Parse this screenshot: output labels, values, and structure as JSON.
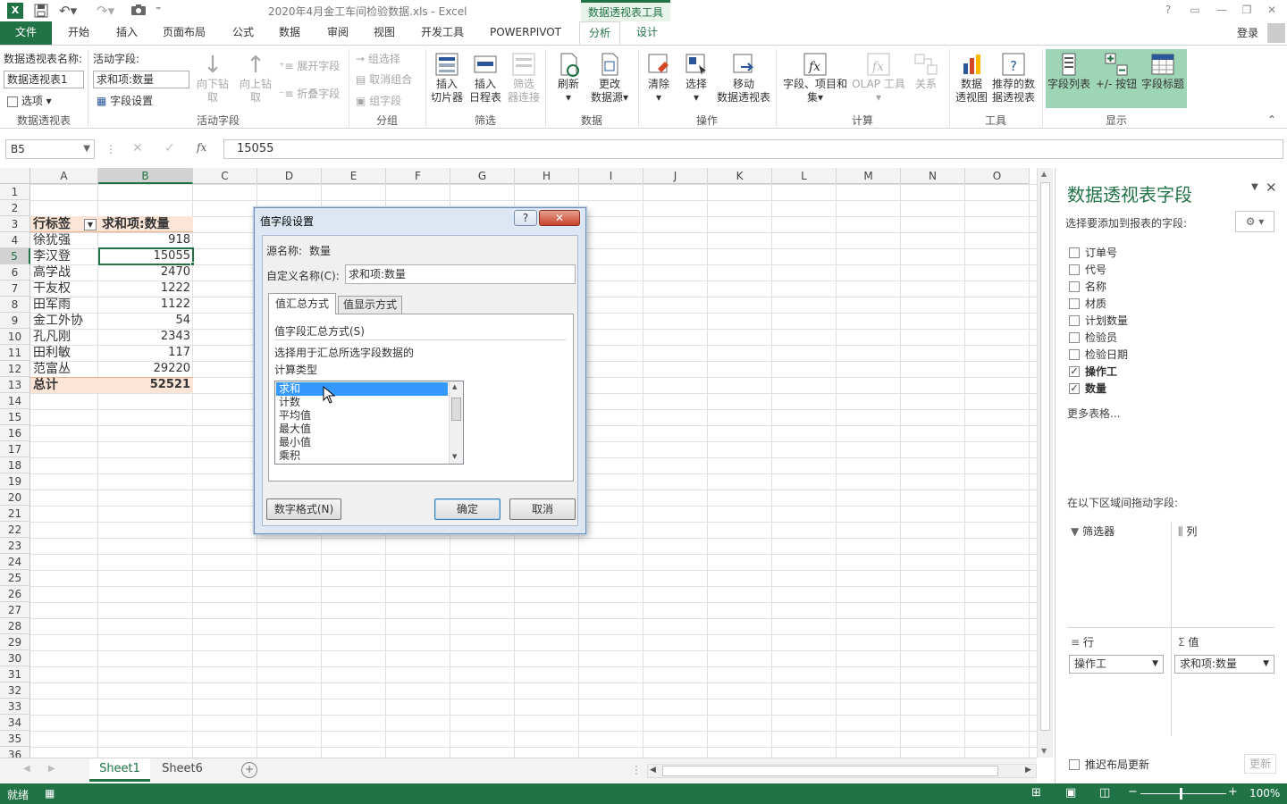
{
  "window": {
    "title": "2020年4月金工车间检验数据.xls - Excel",
    "context_tools": "数据透视表工具",
    "login": "登录"
  },
  "tabs": [
    "文件",
    "开始",
    "插入",
    "页面布局",
    "公式",
    "数据",
    "审阅",
    "视图",
    "开发工具",
    "POWERPIVOT",
    "分析",
    "设计"
  ],
  "ribbon": {
    "pt_name_label": "数据透视表名称:",
    "pt_name_value": "数据透视表1",
    "options_label": "选项",
    "active_field_label": "活动字段:",
    "active_field_value": "求和项:数量",
    "field_settings": "字段设置",
    "drill_down": "向下钻取",
    "drill_up": "向上钻取",
    "expand_field": "展开字段",
    "collapse_field": "折叠字段",
    "group_selection": "组选择",
    "ungroup": "取消组合",
    "group_field": "组字段",
    "insert_slicer_1": "插入",
    "insert_slicer_2": "切片器",
    "insert_timeline_1": "插入",
    "insert_timeline_2": "日程表",
    "filter_conn_1": "筛选",
    "filter_conn_2": "器连接",
    "refresh": "刷新",
    "change_source_1": "更改",
    "change_source_2": "数据源",
    "clear": "清除",
    "select": "选择",
    "move_pt_1": "移动",
    "move_pt_2": "数据透视表",
    "fields_items_1": "字段、项目和",
    "fields_items_2": "集",
    "olap_tools": "OLAP 工具",
    "relationships": "关系",
    "pivot_chart_1": "数据",
    "pivot_chart_2": "透视图",
    "recommended_1": "推荐的数",
    "recommended_2": "据透视表",
    "field_list": "字段列表",
    "buttons": "+/- 按钮",
    "field_headers": "字段标题",
    "groups": {
      "pivot_table": "数据透视表",
      "active_field": "活动字段",
      "group": "分组",
      "filter": "筛选",
      "data": "数据",
      "actions": "操作",
      "calculations": "计算",
      "tools": "工具",
      "show": "显示"
    }
  },
  "formula_bar": {
    "name_box": "B5",
    "formula": "15055",
    "fx": "fx"
  },
  "columns": [
    "A",
    "B",
    "C",
    "D",
    "E",
    "F",
    "G",
    "H",
    "I",
    "J",
    "K",
    "L",
    "M",
    "N",
    "O"
  ],
  "rows": [
    "1",
    "2",
    "3",
    "4",
    "5",
    "6",
    "7",
    "8",
    "9",
    "10",
    "11",
    "12",
    "13",
    "14",
    "15",
    "16",
    "17",
    "18",
    "19",
    "20",
    "21",
    "22",
    "23",
    "24",
    "25",
    "26",
    "27",
    "28",
    "29",
    "30",
    "31",
    "32",
    "33",
    "34",
    "35",
    "36"
  ],
  "pivot": {
    "header_label": "行标签",
    "header_value": "求和项:数量",
    "items": [
      {
        "name": "徐犹强",
        "value": "918"
      },
      {
        "name": "李汉登",
        "value": "15055"
      },
      {
        "name": "高学战",
        "value": "2470"
      },
      {
        "name": "干友权",
        "value": "1222"
      },
      {
        "name": "田军雨",
        "value": "1122"
      },
      {
        "name": "金工外协",
        "value": "54"
      },
      {
        "name": "孔凡刚",
        "value": "2343"
      },
      {
        "name": "田利敏",
        "value": "117"
      },
      {
        "name": "范富丛",
        "value": "29220"
      }
    ],
    "total_label": "总计",
    "total_value": "52521"
  },
  "dialog": {
    "title": "值字段设置",
    "help": "?",
    "source_label": "源名称:",
    "source_value": "数量",
    "custom_name_label": "自定义名称(C):",
    "custom_name_value": "求和项:数量",
    "tab_summarize": "值汇总方式",
    "tab_show_as": "值显示方式",
    "section_title": "值字段汇总方式(S)",
    "description_1": "选择用于汇总所选字段数据的",
    "description_2": "计算类型",
    "calc_types": [
      "求和",
      "计数",
      "平均值",
      "最大值",
      "最小值",
      "乘积"
    ],
    "selected": "求和",
    "number_format": "数字格式(N)",
    "ok": "确定",
    "cancel": "取消"
  },
  "field_pane": {
    "title": "数据透视表字段",
    "subtitle": "选择要添加到报表的字段:",
    "fields": [
      {
        "name": "订单号",
        "checked": false
      },
      {
        "name": "代号",
        "checked": false
      },
      {
        "name": "名称",
        "checked": false
      },
      {
        "name": "材质",
        "checked": false
      },
      {
        "name": "计划数量",
        "checked": false
      },
      {
        "name": "检验员",
        "checked": false
      },
      {
        "name": "检验日期",
        "checked": false
      },
      {
        "name": "操作工",
        "checked": true
      },
      {
        "name": "数量",
        "checked": true
      }
    ],
    "more_tables": "更多表格...",
    "areas_label": "在以下区域间拖动字段:",
    "filters": "筛选器",
    "columns": "列",
    "rows": "行",
    "values": "值",
    "rows_field": "操作工",
    "values_field": "求和项:数量",
    "defer": "推迟布局更新",
    "update": "更新"
  },
  "sheets": [
    "Sheet1",
    "Sheet6"
  ],
  "status": {
    "ready": "就绪",
    "zoom": "100%"
  },
  "colors": {
    "excel_green": "#217346",
    "pivot_header": "#fce4d6",
    "selection_blue": "#3399ff"
  }
}
